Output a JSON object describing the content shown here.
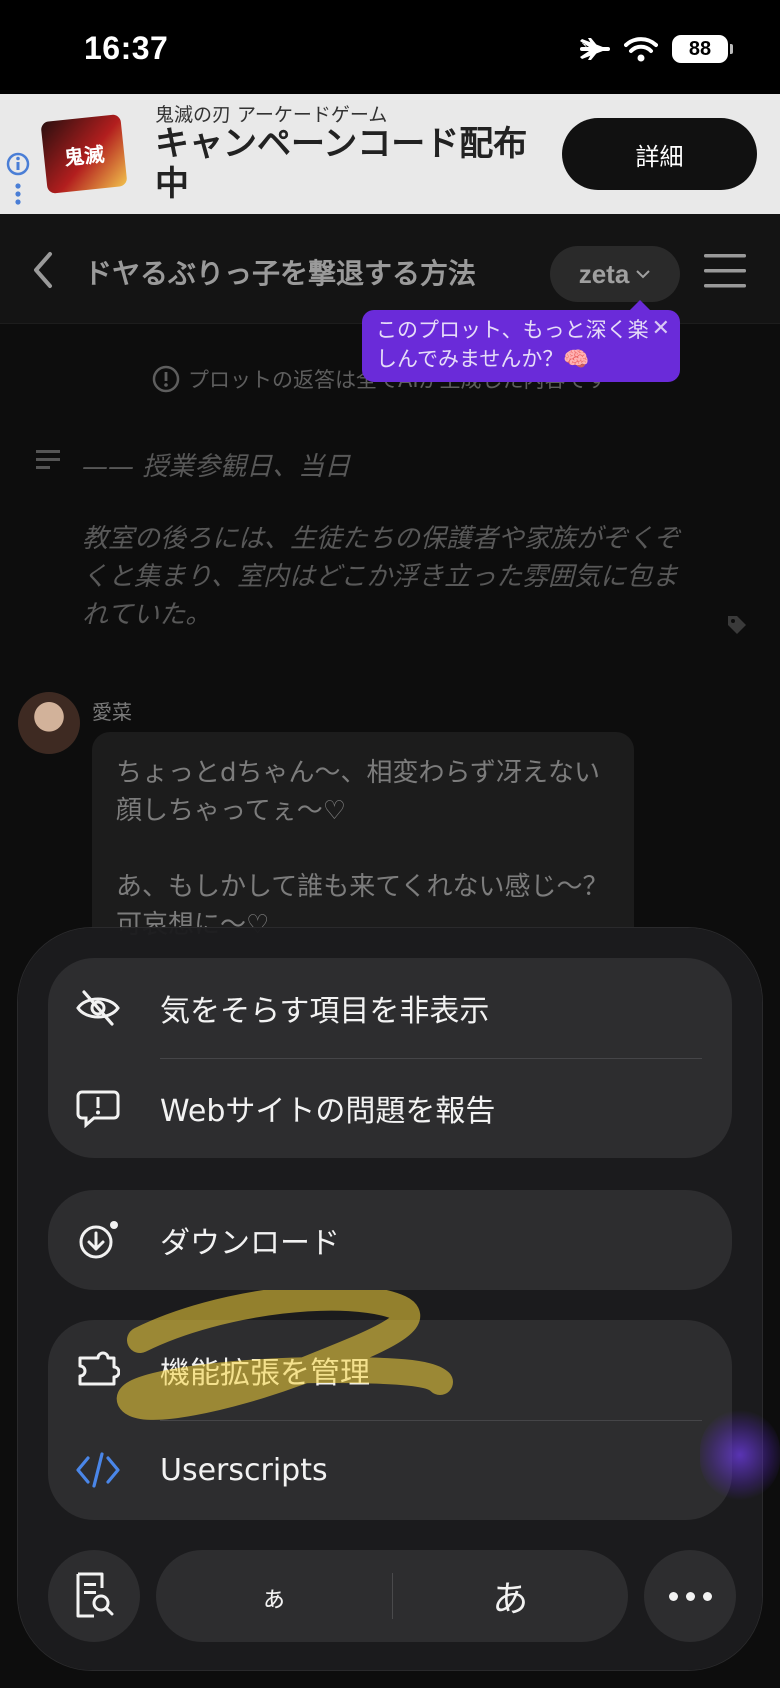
{
  "status_bar": {
    "time": "16:37",
    "battery": "88"
  },
  "ad": {
    "logo_text": "鬼滅",
    "subtitle": "鬼滅の刃 アーケードゲーム",
    "title": "キャンペーンコード配布中",
    "button_label": "詳細"
  },
  "header": {
    "title": "ドヤるぶりっ子を撃退する方法",
    "model": "zeta",
    "tooltip_text": "このプロット、もっと深く楽しんでみませんか？🧠"
  },
  "chat": {
    "notice": "プロットの返答は全てAIが生成した内容です",
    "narration_head": "—— 授業参観日、当日",
    "narration_body": "教室の後ろには、生徒たちの保護者や家族がぞくぞくと集まり、室内はどこか浮き立った雰囲気に包まれていた。",
    "character_name": "愛菜",
    "message": "ちょっとdちゃん〜、相変わらず冴えない顔しちゃってぇ〜♡\n\nあ、もしかして誰も来てくれない感じ〜？ 可哀想に〜♡"
  },
  "menu": {
    "hide_distracting": "気をそらす項目を非表示",
    "report_issue": "Webサイトの問題を報告",
    "downloads": "ダウンロード",
    "manage_extensions": "機能拡張を管理",
    "userscripts": "Userscripts"
  },
  "bottom_bar": {
    "text_small": "ぁ",
    "text_large": "あ"
  },
  "colors": {
    "accent_purple": "#6a2bd9",
    "userscripts_blue": "#4a86e8",
    "highlight_yellow": "#f5d33a"
  }
}
